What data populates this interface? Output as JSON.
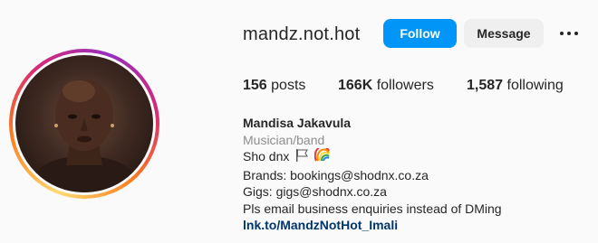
{
  "profile": {
    "username": "mandz.not.hot",
    "follow_label": "Follow",
    "message_label": "Message",
    "more_icon": "more-options-icon"
  },
  "stats": {
    "posts_count": "156",
    "posts_label": "posts",
    "followers_count": "166K",
    "followers_label": "followers",
    "following_count": "1,587",
    "following_label": "following"
  },
  "bio": {
    "full_name": "Mandisa Jakavula",
    "category": "Musician/band",
    "line1": "Sho dnx",
    "line1_emojis": [
      "white-flag-icon",
      "rainbow-icon"
    ],
    "line2": "Brands: bookings@shodnx.co.za",
    "line3": "Gigs: gigs@shodnx.co.za",
    "line4": "Pls email business enquiries instead of DMing",
    "link": "lnk.to/MandzNotHot_Imali"
  },
  "colors": {
    "accent": "#0095f6",
    "link": "#00376b",
    "secondary_text": "#8e8e8e",
    "button_gray": "#efefef"
  }
}
